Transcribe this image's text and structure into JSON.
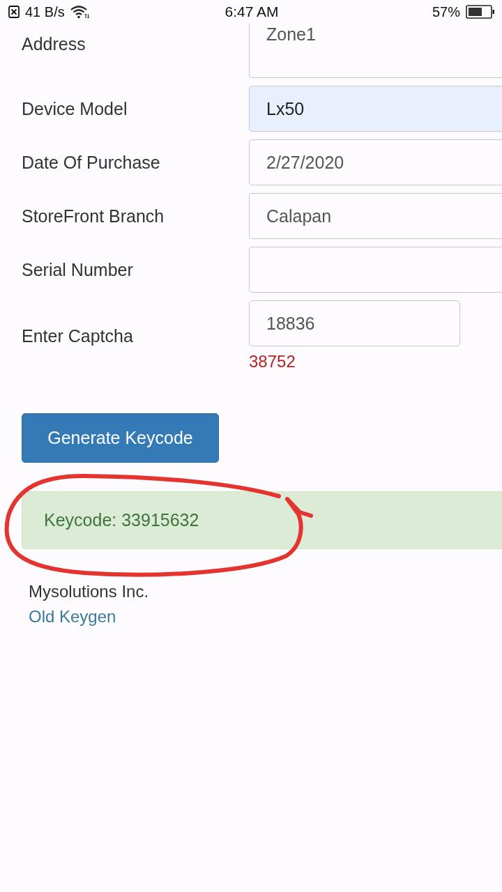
{
  "status_bar": {
    "speed": "41 B/s",
    "time": "6:47 AM",
    "battery": "57%"
  },
  "form": {
    "fields": [
      {
        "kind": "textarea",
        "label": "Address",
        "value": "Zone1",
        "highlighted": false
      },
      {
        "kind": "text",
        "label": "Device Model",
        "value": "Lx50",
        "highlighted": true
      },
      {
        "kind": "text",
        "label": "Date Of Purchase",
        "value": "2/27/2020",
        "highlighted": false
      },
      {
        "kind": "text",
        "label": "StoreFront Branch",
        "value": "Calapan",
        "highlighted": false
      },
      {
        "kind": "text",
        "label": "Serial Number",
        "highlighted": false
      },
      {
        "kind": "captcha",
        "label": "Enter Captcha",
        "value": "18836",
        "highlighted": false,
        "code": "38752"
      }
    ],
    "submit_button": "Generate Keycode"
  },
  "alert": {
    "text": "Keycode: 33915632"
  },
  "footer": {
    "company": "Mysolutions Inc.",
    "link": "Old Keygen"
  }
}
